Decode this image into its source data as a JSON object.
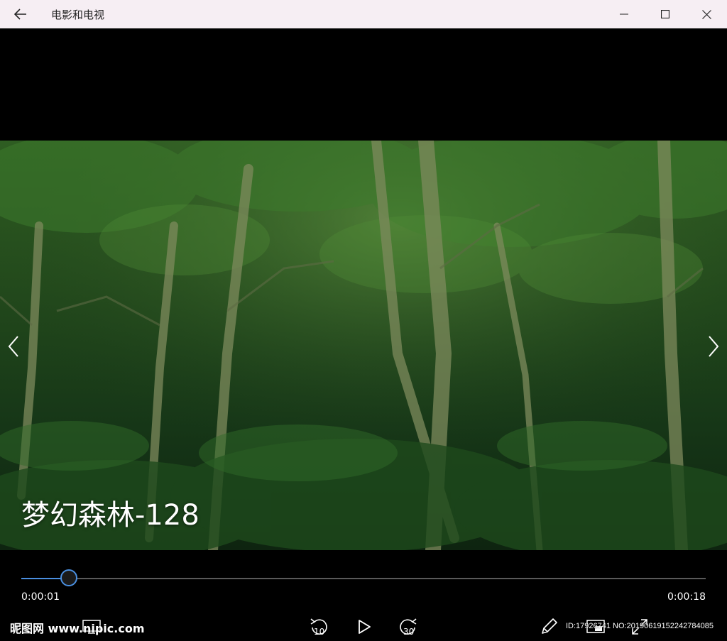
{
  "titlebar": {
    "app_title": "电影和电视",
    "back_icon": "arrow-left-icon",
    "minimize_icon": "minimize-icon",
    "maximize_icon": "maximize-icon",
    "close_icon": "close-icon"
  },
  "video": {
    "title": "梦幻森林-128",
    "prev_icon": "chevron-left-icon",
    "next_icon": "chevron-right-icon"
  },
  "playback": {
    "current_time": "0:00:01",
    "total_time": "0:00:18",
    "progress_fraction": 0.07,
    "accent_color": "#4a8fe0"
  },
  "controls": {
    "skip_back_label": "10",
    "skip_forward_label": "30",
    "skip_back_icon": "rewind-icon",
    "play_icon": "play-icon",
    "skip_forward_icon": "fast-forward-icon",
    "edit_icon": "pencil-icon",
    "expand_icon": "fullscreen-icon"
  },
  "watermark": {
    "logo_text": "昵图网 www.nipic.com",
    "id_text": "ID:17926741 NO:20190619152242784085"
  }
}
